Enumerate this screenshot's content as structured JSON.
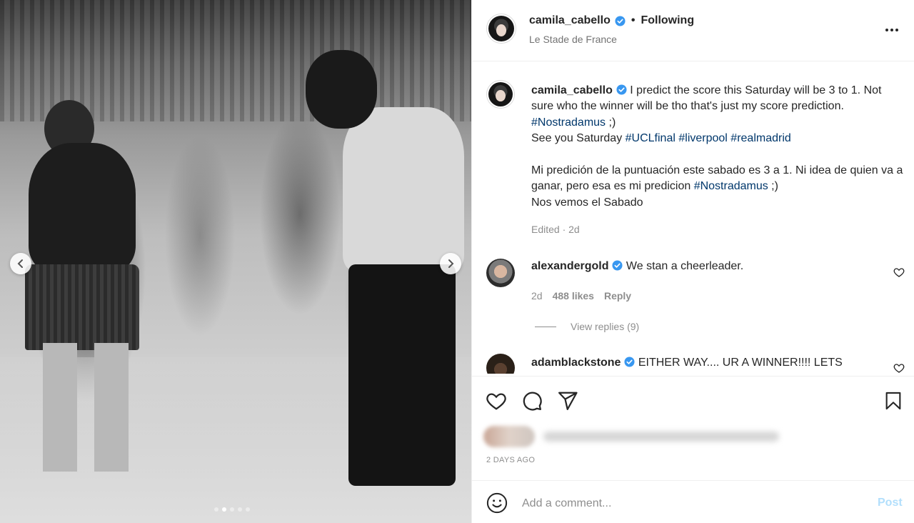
{
  "post": {
    "username": "camila_cabello",
    "follow_label": "Following",
    "location": "Le Stade de France",
    "carousel": {
      "dots": 5,
      "active_index": 1
    }
  },
  "caption": {
    "username": "camila_cabello",
    "segments": [
      {
        "text": " I predict the score this Saturday will be 3 to 1. Not sure who the winner will be tho that's just my score prediction. ",
        "tag": false
      },
      {
        "text": "#Nostradamus",
        "tag": true
      },
      {
        "text": " ;)\nSee you Saturday ",
        "tag": false
      },
      {
        "text": "#UCLfinal",
        "tag": true
      },
      {
        "text": " ",
        "tag": false
      },
      {
        "text": "#liverpool",
        "tag": true
      },
      {
        "text": " ",
        "tag": false
      },
      {
        "text": "#realmadrid",
        "tag": true
      },
      {
        "text": "\n\nMi predición de la puntuación este sabado es 3 a 1. Ni idea de quien va a ganar, pero esa es mi predicion ",
        "tag": false
      },
      {
        "text": "#Nostradamus",
        "tag": true
      },
      {
        "text": " ;)\nNos vemos el Sabado",
        "tag": false
      }
    ],
    "edited": "Edited · 2d"
  },
  "comments": [
    {
      "username": "alexandergold",
      "text": " We stan a cheerleader.",
      "age": "2d",
      "likes": "488 likes",
      "reply_label": "Reply",
      "view_replies": "View replies (9)"
    },
    {
      "username": "adamblackstone",
      "text": " EITHER WAY.... UR A WINNER!!!! LETS"
    }
  ],
  "timestamp": "2 DAYS AGO",
  "add_comment": {
    "placeholder": "Add a comment...",
    "post_label": "Post"
  },
  "colors": {
    "verified": "#3897f0",
    "hashtag": "#00376b",
    "post_disabled": "#b2dffc",
    "muted": "#8e8e8e"
  }
}
